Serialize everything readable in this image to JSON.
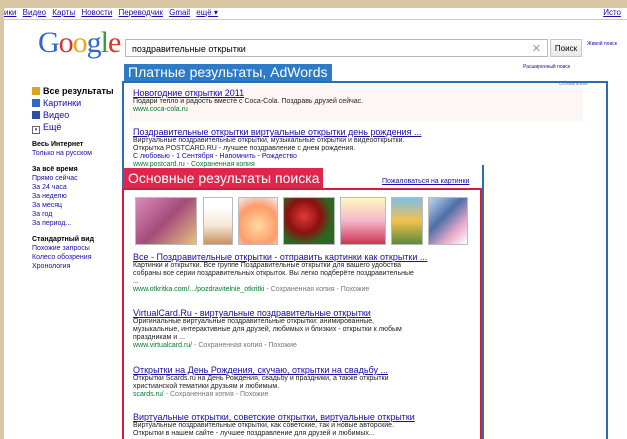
{
  "topbar": {
    "items": [
      "ики",
      "Видео",
      "Карты",
      "Новости",
      "Переводчик",
      "Gmail",
      "ещё ▾"
    ],
    "right": "Исто"
  },
  "search": {
    "query": "поздравительные открытки",
    "button": "Поиск",
    "advanced": "Расширенный поиск",
    "side_link": "Живой поиск"
  },
  "sidebar": {
    "nav": [
      {
        "label": "Все результаты",
        "icon": "all-results-icon",
        "color": "#e0a020"
      },
      {
        "label": "Картинки",
        "icon": "images-icon",
        "color": "#3266cc"
      },
      {
        "label": "Видео",
        "icon": "video-icon",
        "color": "#2a4fa8"
      },
      {
        "label": "Ещё",
        "icon": "more-icon",
        "color": "#666666"
      }
    ],
    "section1": {
      "title": "Весь Интернет",
      "items": [
        "Только на русском"
      ]
    },
    "section2": {
      "title": "За всё время",
      "items": [
        "Прямо сейчас",
        "За 24 часа",
        "За неделю",
        "За месяц",
        "За год",
        "За период..."
      ]
    },
    "section3": {
      "title": "Стандартный вид",
      "items": [
        "Похожие запросы",
        "Колесо обозрения",
        "Хронология"
      ]
    }
  },
  "annotations": {
    "paid": "Платные результаты, AdWords",
    "organic": "Основные результаты поиска",
    "paid_color": "#2d7bc6",
    "organic_color": "#e0264c"
  },
  "ad_label": "Объявление",
  "complain": "Пожаловаться на картинки",
  "results": [
    {
      "title": "Новогодние открытки 2011",
      "snippet": [
        "Подари тепло и радость вместе с Coca-Cola. Поздравь друзей сейчас."
      ],
      "url": "www.coca-cola.ru"
    },
    {
      "title": "Поздравительные открытки виртуальные открытки день рождения ...",
      "snippet": [
        "Виртуальные поздравительные открытки, музыкальные открытки и видеооткрытки.",
        "Открытка POSTCARD.RU - лучшее поздравление с днем рождения.",
        "С любовью - 1 Сентября - Напомнить - Рождество"
      ],
      "url": "www.postcard.ru - Сохраненная копия"
    },
    {
      "title": "Все - Поздравительные открытки - отправить картинки как открытки ...",
      "snippet": [
        "Картинки и открытки. Все группе Поздравительные открытки для вашего удобства",
        "собраны все серии поздравительных открыток. Вы легко подберёте поздравительные",
        "..."
      ],
      "url": "www.otkritka.com/.../pozdravitelnie_otkritki",
      "cache": " - Сохраненная копия - Похожие"
    },
    {
      "title": "VirtualCard.Ru - виртуальные поздравительные открытки",
      "snippet": [
        "Оригинальные виртуальные поздравительные открытки: анимированные,",
        "музыкальные, интерактивные для друзей, любимых и близких - открытки к любым",
        "праздникам и ..."
      ],
      "url": "www.virtualcard.ru/",
      "cache": " - Сохраненная копия - Похожие"
    },
    {
      "title": "Открытки на День Рождения, скучаю, открытки на свадьбу ...",
      "snippet": [
        "Открытки Scards.ru на День Рождения, свадьбу и праздники, а также открытки",
        "христианской тематики друзьям и любимым."
      ],
      "url": "scards.ru/",
      "cache": " - Сохраненная копия - Похожие"
    },
    {
      "title": "Виртуальные открытки, советские открытки, виртуальные открытки",
      "snippet": [
        "Виртуальные поздравительные открытки, как советские, так и новые авторские.",
        "Открытки в нашем сайте - лучшее поздравление для друзей и любимых..."
      ],
      "url": "",
      "cache": ""
    }
  ]
}
